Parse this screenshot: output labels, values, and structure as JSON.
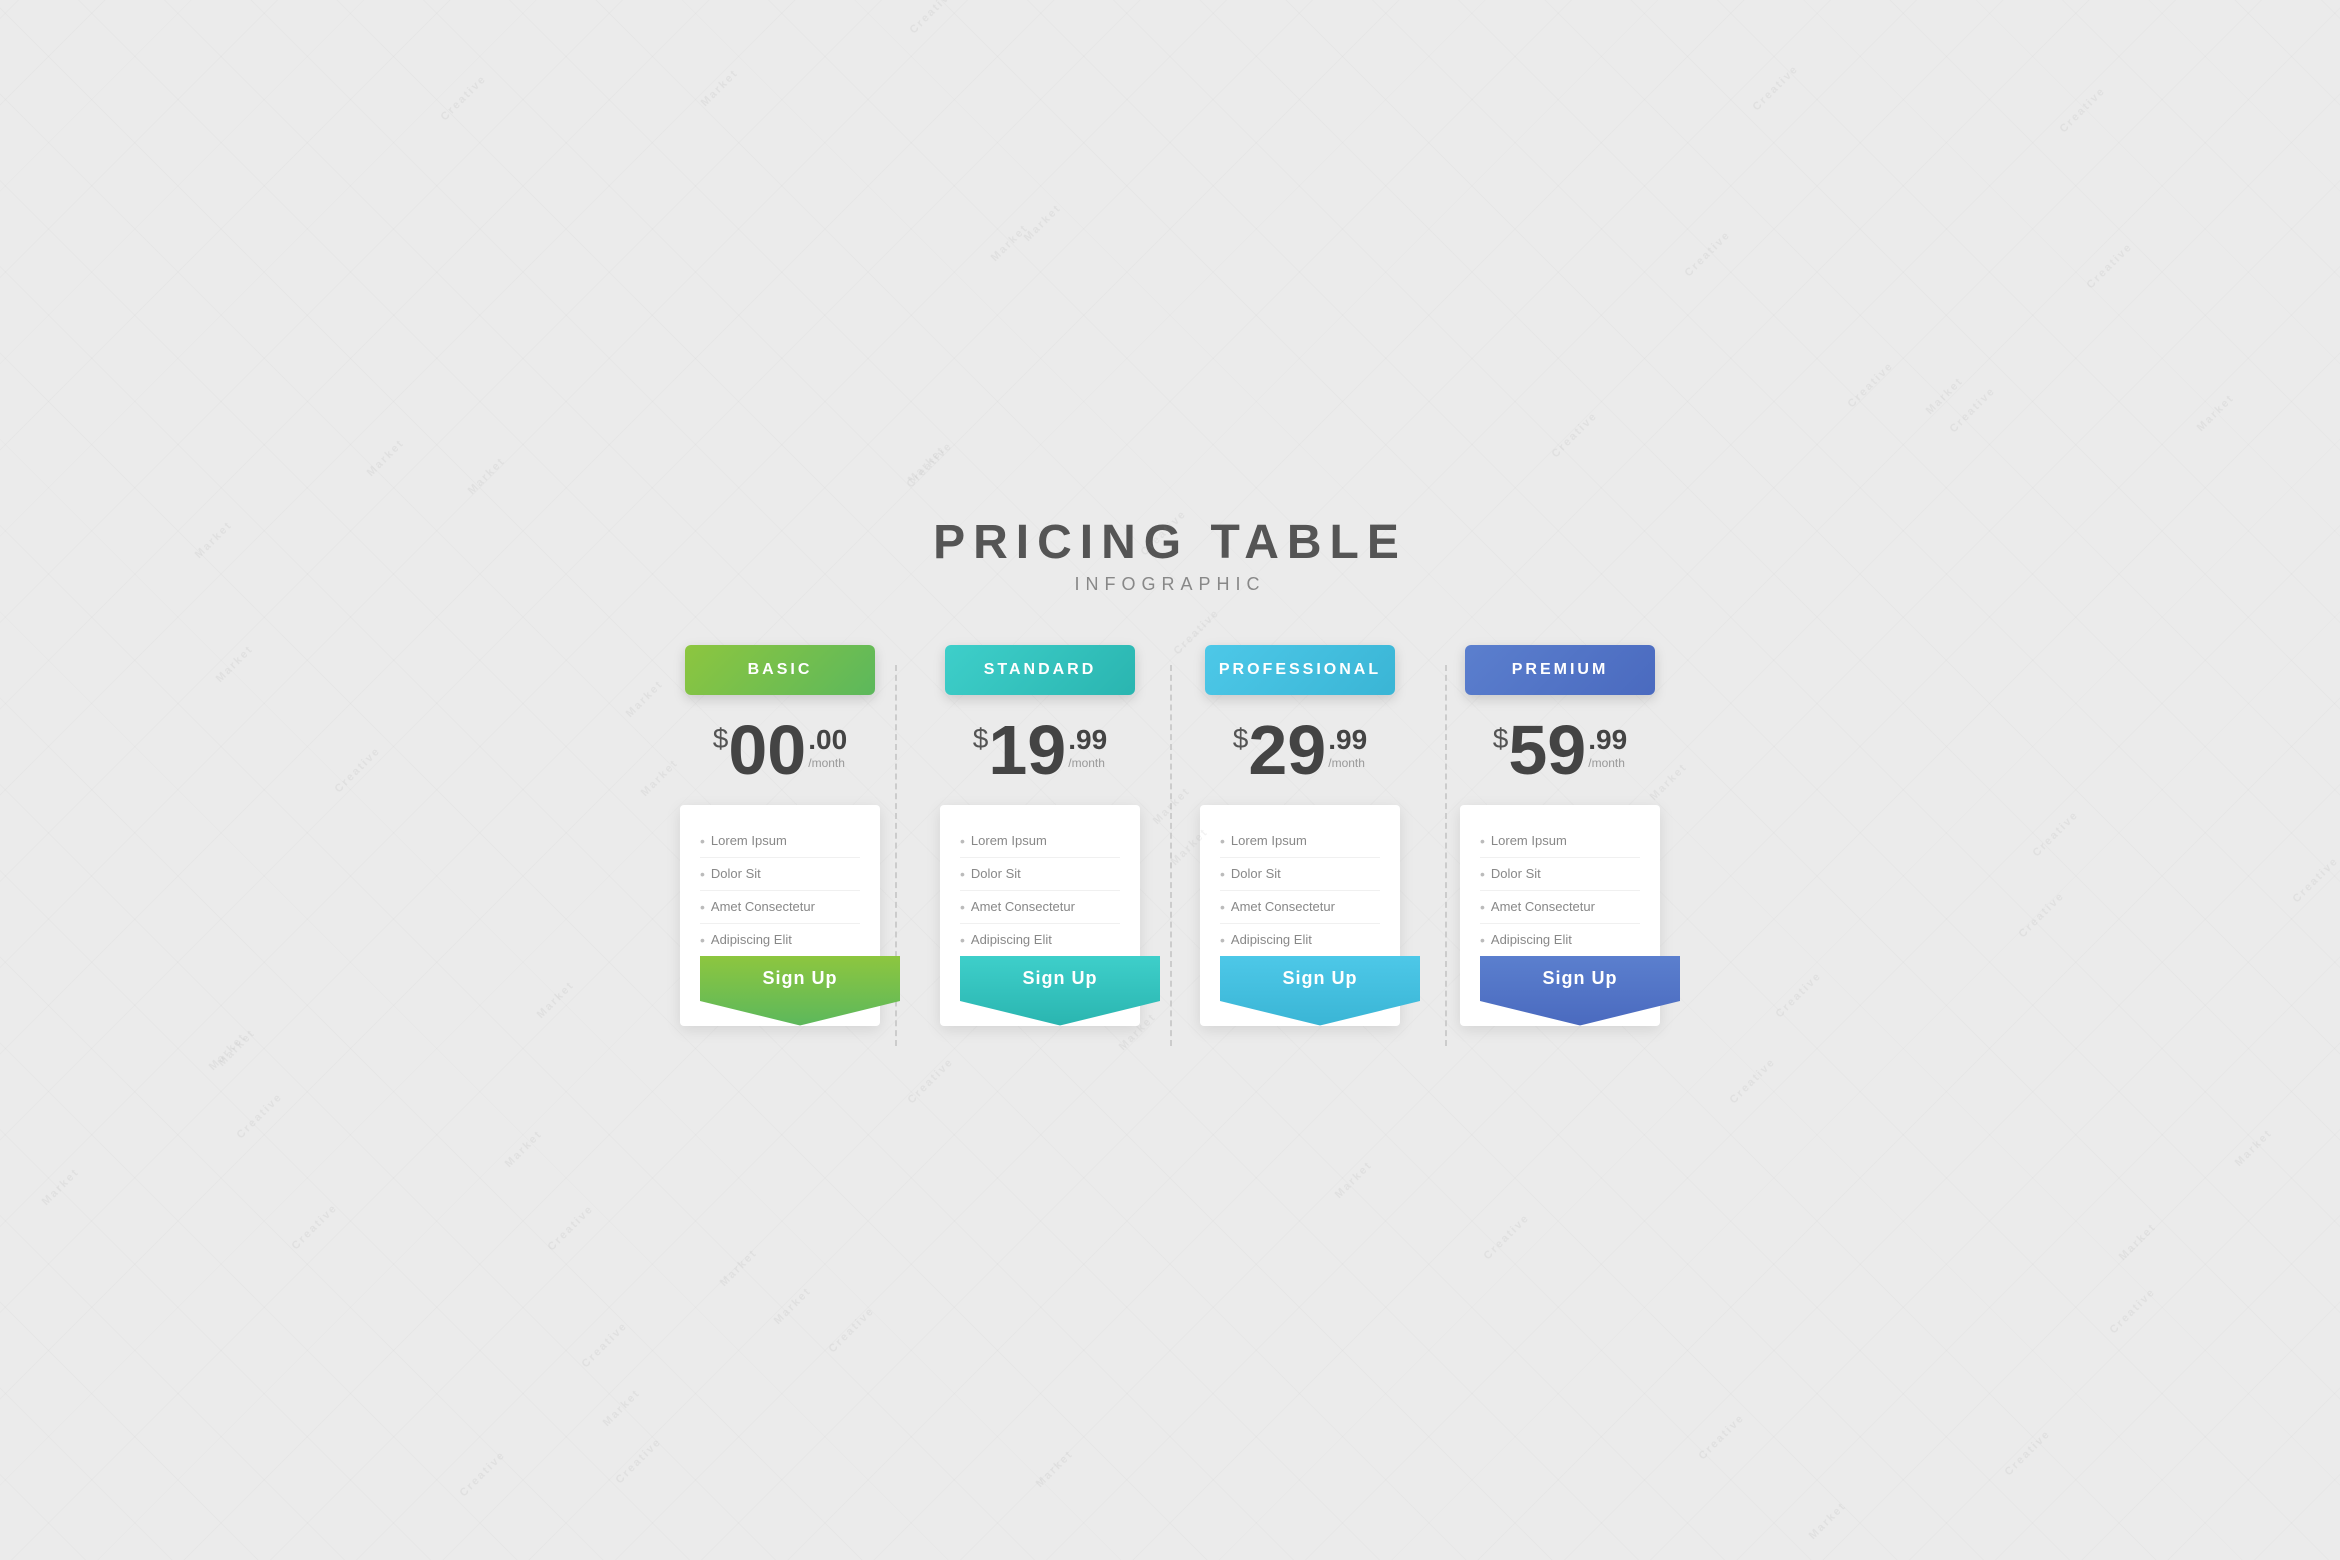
{
  "header": {
    "title": "PRICING TABLE",
    "subtitle": "INFOGRAPHIC"
  },
  "plans": [
    {
      "id": "basic",
      "name": "BASIC",
      "color_class": "basic",
      "price_main": "00",
      "price_decimal": "00",
      "price_period": "/month",
      "features": [
        "Lorem Ipsum",
        "Dolor Sit",
        "Amet Consectetur",
        "Adipiscing Elit"
      ],
      "cta": "Sign Up"
    },
    {
      "id": "standard",
      "name": "STANDARD",
      "color_class": "standard",
      "price_main": "19",
      "price_decimal": "99",
      "price_period": "/month",
      "features": [
        "Lorem Ipsum",
        "Dolor Sit",
        "Amet Consectetur",
        "Adipiscing Elit"
      ],
      "cta": "Sign Up"
    },
    {
      "id": "professional",
      "name": "PROFESSIONAL",
      "color_class": "professional",
      "price_main": "29",
      "price_decimal": "99",
      "price_period": "/month",
      "features": [
        "Lorem Ipsum",
        "Dolor Sit",
        "Amet Consectetur",
        "Adipiscing Elit"
      ],
      "cta": "Sign Up"
    },
    {
      "id": "premium",
      "name": "PREMIUM",
      "color_class": "premium",
      "price_main": "59",
      "price_decimal": "99",
      "price_period": "/month",
      "features": [
        "Lorem Ipsum",
        "Dolor Sit",
        "Amet Consectetur",
        "Adipiscing Elit"
      ],
      "cta": "Sign Up"
    }
  ],
  "price_symbol": "$"
}
